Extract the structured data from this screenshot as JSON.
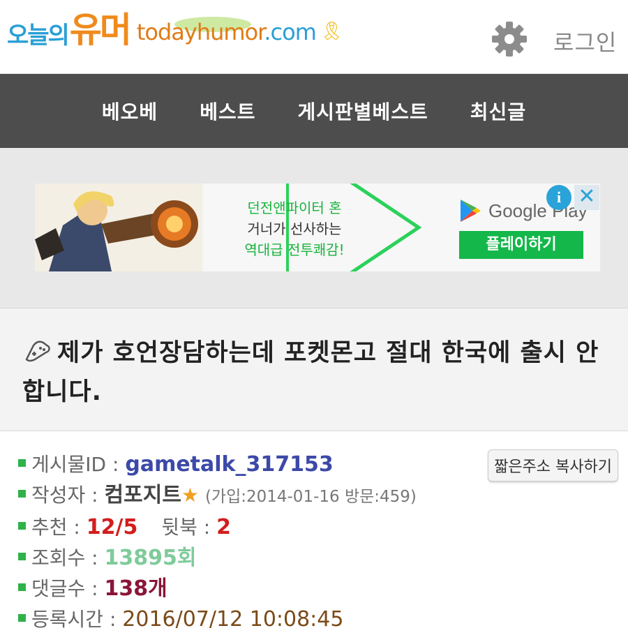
{
  "header": {
    "logo_kr_small": "오늘의",
    "logo_kr_big": "유머",
    "logo_en_main": "todayhumor",
    "logo_en_tld": ".com",
    "login_label": "로그인",
    "settings_icon": "gear-icon"
  },
  "nav": {
    "items": [
      {
        "label": "베오베"
      },
      {
        "label": "베스트"
      },
      {
        "label": "게시판별베스트"
      },
      {
        "label": "최신글"
      }
    ]
  },
  "ad": {
    "line1": "던전앤파이터 혼",
    "line2": "거너가 선사하는",
    "line3": "역대급 전투쾌감!",
    "store_label": "Google Play",
    "play_button": "플레이하기",
    "info_icon": "i"
  },
  "post": {
    "title": "제가 호언장담하는데 포켓몬고 절대 한국에 출시 안합니다.",
    "copy_button": "짧은주소 복사하기",
    "id_label": "게시물ID : ",
    "id_value": "gametalk_317153",
    "author_label": "작성자 : ",
    "author_value": "컴포지트",
    "author_star": "★",
    "author_meta": "(가입:2014-01-16 방문:459)",
    "recommend_label": "추천 : ",
    "recommend_value": "12/5",
    "downvote_label": "뒷북 : ",
    "downvote_value": "2",
    "views_label": "조회수 : ",
    "views_value": "13895회",
    "comments_label": "댓글수 : ",
    "comments_value": "138개",
    "date_label": "등록시간 : ",
    "date_value": "2016/07/12 10:08:45"
  },
  "colors": {
    "nav_bg": "#4d4d4d",
    "bullet": "#2fb24a",
    "id": "#3c49a8",
    "recommend": "#d31d1d",
    "views": "#7fcb9a",
    "comments": "#8a1538"
  }
}
